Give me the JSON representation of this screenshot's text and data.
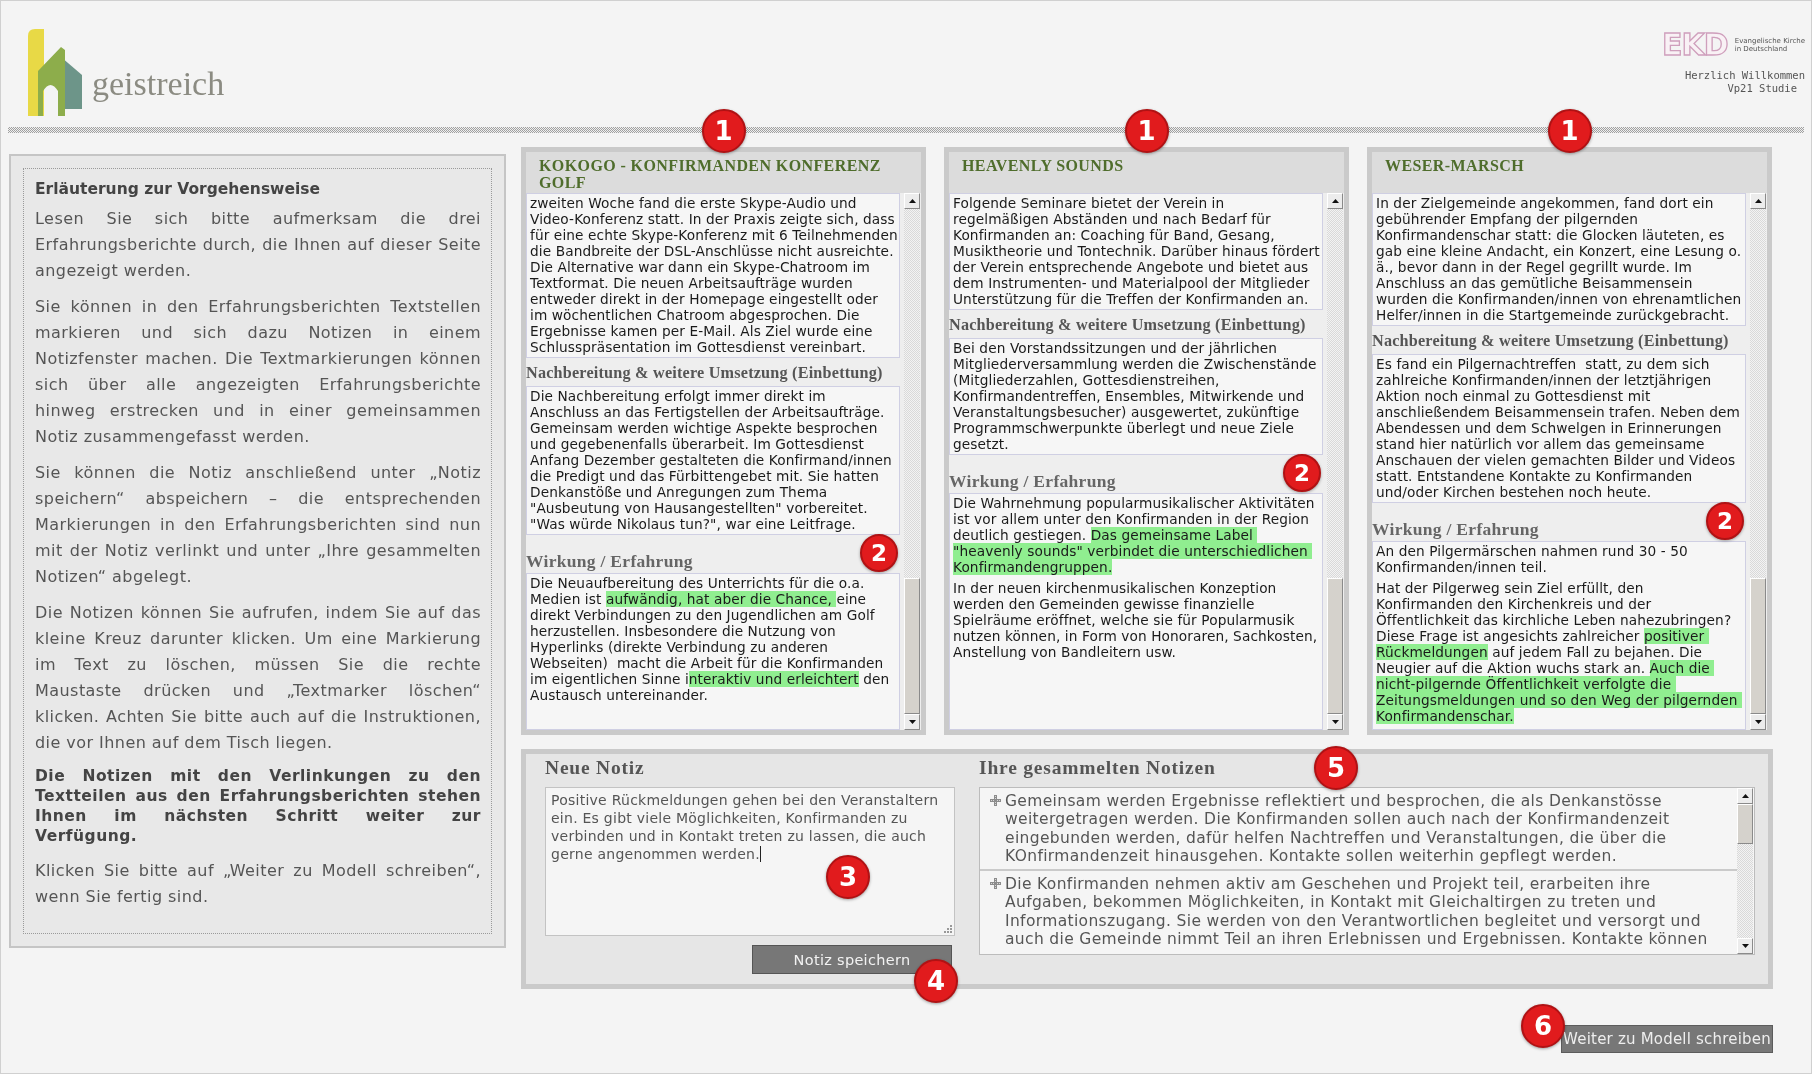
{
  "header": {
    "logo_text": "geistreich",
    "partner": {
      "mark": "EKD",
      "name_lines": [
        "Evangelische Kirche",
        "in Deutschland"
      ]
    },
    "welcome_lines": [
      "Herzlich Willkommen",
      "Vp21 Studie"
    ]
  },
  "instructions": {
    "title": "Erläuterung zur Vorgehensweise",
    "paragraphs": [
      {
        "kind": "plain",
        "text": "Lesen Sie sich bitte aufmerksam die drei Erfahrungsberichte durch, die Ihnen auf dieser Seite angezeigt werden."
      },
      {
        "kind": "plain",
        "text": "Sie können in den Erfahrungsberichten Textstellen markieren und sich dazu Notizen in einem Notizfenster machen. Die Textmarkierungen können sich über alle angezeigten Erfahrungsberichte hinweg erstrecken und in einer gemeinsammen Notiz zusammengefasst werden."
      },
      {
        "kind": "plain",
        "text": "Sie können die Notiz anschließend unter „Notiz speichern“ abspeichern – die entsprechenden Markierungen in den Erfahrungsberichten sind nun mit der Notiz verlinkt und unter „Ihre gesammelten Notizen“ abgelegt."
      },
      {
        "kind": "plain",
        "text": "Die Notizen können Sie aufrufen, indem Sie auf das kleine Kreuz darunter klicken. Um eine Markierung im Text zu löschen, müssen Sie die rechte Maustaste drücken und „Textmarker löschen“ klicken. Achten Sie bitte auch auf die Instruktionen, die vor Ihnen auf dem Tisch liegen."
      },
      {
        "kind": "bold",
        "text": "Die Notizen mit den Verlinkungen zu den Textteilen aus den Erfahrungsberichten stehen Ihnen im nächsten Schritt weiter zur Verfügung."
      },
      {
        "kind": "plain",
        "text": "Klicken Sie bitte auf „Weiter zu Modell schreiben“, wenn Sie fertig sind."
      }
    ]
  },
  "reports": [
    {
      "title": "KOKOGO - KONFIRMANDEN KONFERENZ GOLF",
      "marker": "1",
      "sections": [
        {
          "kind": "body",
          "paragraphs": [
            {
              "segments": [
                {
                  "text": "zweiten Woche fand die erste Skype-Audio und Video-Konferenz statt. In der Praxis zeigte sich, dass für eine echte Skype-Konferenz mit 6 Teilnehmenden die Bandbreite der DSL-Anschlüsse nicht ausreichte. Die Alternative war dann ein Skype-Chatroom im Textformat. Die neuen Arbeitsaufträge wurden entweder direkt in der Homepage eingestellt oder im wöchentlichen Chatroom abgesprochen. Die Ergebnisse kamen per E-Mail. Als Ziel wurde eine Schlusspräsentation im Gottesdienst vereinbart.",
                  "highlighted": false
                }
              ]
            }
          ]
        },
        {
          "kind": "subheading",
          "heading": "Nachbereitung & weitere Umsetzung (Einbettung)",
          "paragraphs": [
            {
              "segments": [
                {
                  "text": "Die Nachbereitung erfolgt immer direkt im Anschluss an das Fertigstellen der Arbeitsaufträge. Gemeinsam werden wichtige Aspekte besprochen und gegebenenfalls überarbeit. Im Gottesdienst Anfang Dezember gestalteten die Konfirmand/innen die Predigt und das Fürbittengebet mit. Sie hatten Denkanstöße und Anregungen zum Thema \"Ausbeutung von Hausangestellten\" vorbereitet. \"Was würde Nikolaus tun?\", war eine Leitfrage.",
                  "highlighted": false
                }
              ]
            }
          ]
        },
        {
          "kind": "heading",
          "heading": "Wirkung / Erfahrung",
          "marker": "2",
          "paragraphs": [
            {
              "segments": [
                {
                  "text": "Die Neuaufbereitung des Unterrichts für die o.a. Medien ist ",
                  "highlighted": false
                },
                {
                  "text": "aufwändig, hat aber die Chance, ",
                  "highlighted": true
                },
                {
                  "text": "eine direkt Verbindungen zu den Jugendlichen am Golf herzustellen. Insbesondere die Nutzung von Hyperlinks (direkte Verbindung zu anderen Webseiten)  macht die Arbeit für die Konfirmanden im eigentlichen Sinne i",
                  "highlighted": false
                },
                {
                  "text": "nteraktiv und erleichtert",
                  "highlighted": true
                },
                {
                  "text": " den Austausch untereinander.",
                  "highlighted": false
                }
              ]
            }
          ]
        }
      ]
    },
    {
      "title": "HEAVENLY SOUNDS",
      "marker": "1",
      "sections": [
        {
          "kind": "body",
          "paragraphs": [
            {
              "segments": [
                {
                  "text": "Folgende Seminare bietet der Verein in regelmäßigen Abständen und nach Bedarf für Konfirmanden an: Coaching für Band, Gesang, Musiktheorie und Tontechnik. Darüber hinaus fördert der Verein entsprechende Angebote und bietet aus dem Instrumenten- und Materialpool der Mitglieder Unterstützung für die Treffen der Konfirmanden an.",
                  "highlighted": false
                }
              ]
            }
          ]
        },
        {
          "kind": "subheading",
          "heading": "Nachbereitung & weitere Umsetzung (Einbettung)",
          "paragraphs": [
            {
              "segments": [
                {
                  "text": "Bei den Vorstandssitzungen und der jährlichen Mitgliederversammlung werden die Zwischenstände (Mitgliederzahlen, Gottesdienstreihen, Konfirmandentreffen, Ensembles, Mitwirkende und Veranstaltungsbesucher) ausgewertet, zukünftige Programmschwerpunkte überlegt und neue Ziele gesetzt.",
                  "highlighted": false
                }
              ]
            }
          ]
        },
        {
          "kind": "heading",
          "heading": "Wirkung / Erfahrung",
          "marker": "2",
          "paragraphs": [
            {
              "segments": [
                {
                  "text": "Die Wahrnehmung popularmusikalischer Aktivitäten ist vor allem unter den Konfirmanden in der Region deutlich gestiegen. ",
                  "highlighted": false
                },
                {
                  "text": "Das gemeinsame Label \"heavenly sounds\" verbindet die unterschiedlichen Konfirmandengruppen.",
                  "highlighted": true
                }
              ]
            },
            {
              "segments": [
                {
                  "text": "In der neuen kirchenmusikalischen Konzeption werden den Gemeinden gewisse finanzielle Spielräume eröffnet, welche sie für Popularmusik nutzen können, in Form von Honoraren, Sachkosten, Anstellung von Bandleitern usw.",
                  "highlighted": false
                }
              ]
            }
          ]
        }
      ]
    },
    {
      "title": "WESER-MARSCH",
      "marker": "1",
      "sections": [
        {
          "kind": "body",
          "paragraphs": [
            {
              "segments": [
                {
                  "text": "In der Zielgemeinde angekommen, fand dort ein gebührender Empfang der pilgernden Konfirmandenschar statt: die Glocken läuteten, es gab eine kleine Andacht, ein Konzert, eine Lesung o. ä., bevor dann in der Regel gegrillt wurde. Im Anschluss an das gemütliche Beisammensein wurden die Konfirmanden/innen von ehrenamtlichen Helfer/innen in die Startgemeinde zurückgebracht.",
                  "highlighted": false
                }
              ]
            }
          ]
        },
        {
          "kind": "subheading",
          "heading": "Nachbereitung & weitere Umsetzung (Einbettung)",
          "paragraphs": [
            {
              "segments": [
                {
                  "text": "Es fand ein Pilgernachtreffen  statt, zu dem sich zahlreiche Konfirmanden/innen der letztjährigen Aktion noch einmal zu Gottesdienst mit anschließendem Beisammensein trafen. Neben dem Abendessen und dem Schwelgen in Erinnerungen stand hier natürlich vor allem das gemeinsame Anschauen der vielen gemachten Bilder und Videos statt. Entstandene Kontakte zu Konfirmanden und/oder Kirchen bestehen noch heute.",
                  "highlighted": false
                }
              ]
            }
          ]
        },
        {
          "kind": "heading",
          "heading": "Wirkung / Erfahrung",
          "marker": "2",
          "paragraphs": [
            {
              "segments": [
                {
                  "text": "An den Pilgermärschen nahmen rund 30 - 50 Konfirmanden/innen teil.",
                  "highlighted": false
                }
              ]
            },
            {
              "segments": [
                {
                  "text": "Hat der Pilgerweg sein Ziel erfüllt, den Konfirmanden den Kirchenkreis und der Öffentlichkeit das kirchliche Leben nahezubringen? Diese Frage ist angesichts zahlreicher ",
                  "highlighted": false
                },
                {
                  "text": "positiver Rückmeldungen",
                  "highlighted": true
                },
                {
                  "text": " auf jedem Fall zu bejahen. Die Neugier auf die Aktion wuchs stark an. ",
                  "highlighted": false
                },
                {
                  "text": "Auch die nicht-pilgernde Öffentlichkeit verfolgte die Zeitungsmeldungen und so den Weg der pilgernden Konfirmandenschar.",
                  "highlighted": true
                }
              ]
            }
          ]
        }
      ]
    }
  ],
  "new_note": {
    "heading": "Neue Notiz",
    "value": "Positive Rückmeldungen gehen bei den Veranstaltern ein. Es gibt viele Möglichkeiten, Konfirmanden zu verbinden und in Kontakt treten zu lassen, die auch gerne angenommen werden.",
    "marker": "3",
    "save_button": {
      "label": "Notiz speichern",
      "marker": "4"
    }
  },
  "saved_notes": {
    "heading": "Ihre gesammelten Notizen",
    "marker": "5",
    "notes": [
      {
        "text": "Gemeinsam werden Ergebnisse reflektiert und besprochen, die als Denkanstösse weitergetragen werden. Die Konfirmanden sollen auch nach der Konfirmandenzeit eingebunden werden, dafür helfen Nachtreffen und Veranstaltungen, die über die KOnfirmandenzeit hinausgehen. Kontakte sollen weiterhin gepflegt werden."
      },
      {
        "text": "Die Konfirmanden nehmen aktiv am Geschehen und Projekt teil, erarbeiten ihre Aufgaben, bekommen Möglichkeiten, in Kontakt mit Gleichaltirgen zu treten und Informationszugang. Sie werden von den Verantwortlichen begleitet und versorgt und auch die Gemeinde nimmt Teil an ihren Erlebnissen und Ergebnissen. Kontakte können"
      }
    ]
  },
  "next_button": {
    "label": "Weiter zu Modell schreiben",
    "marker": "6"
  }
}
